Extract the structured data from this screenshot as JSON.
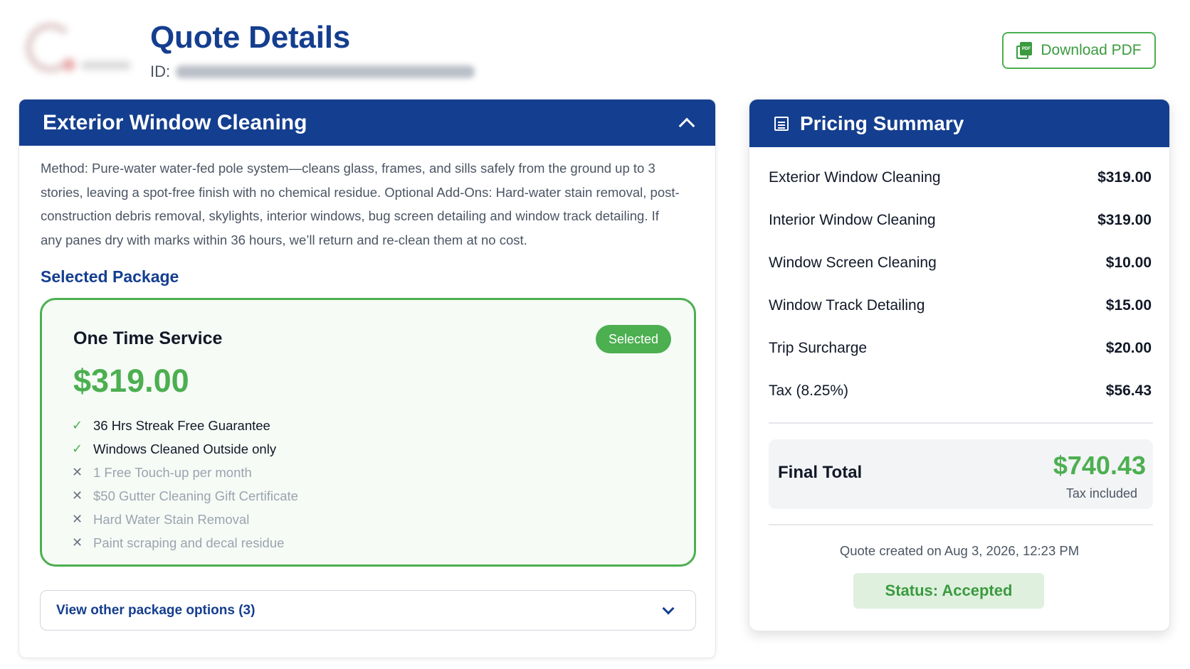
{
  "header": {
    "title": "Quote Details",
    "id_label": "ID:",
    "download_label": "Download PDF",
    "download_icon": "pdf-icon",
    "pdf_icon_text": "PDF"
  },
  "service": {
    "title": "Exterior Window Cleaning",
    "description": "Method: Pure-water water-fed pole system—cleans glass, frames, and sills safely from the ground up to 3 stories, leaving a spot-free finish with no chemical residue. Optional Add-Ons: Hard-water stain removal, post-construction debris removal, skylights, interior windows, bug screen detailing and window track detailing. If any panes dry with marks within 36 hours, we’ll return and re-clean them at no cost.",
    "selected_package_label": "Selected Package",
    "package": {
      "name": "One Time Service",
      "badge": "Selected",
      "price": "$319.00",
      "features": [
        {
          "text": "36 Hrs Streak Free Guarantee",
          "included": true,
          "icon": "✓"
        },
        {
          "text": "Windows Cleaned Outside only",
          "included": true,
          "icon": "✓"
        },
        {
          "text": "1 Free Touch-up per month",
          "included": false,
          "icon": "✕"
        },
        {
          "text": "$50 Gutter Cleaning Gift Certificate",
          "included": false,
          "icon": "✕"
        },
        {
          "text": "Hard Water Stain Removal",
          "included": false,
          "icon": "✕"
        },
        {
          "text": "Paint scraping and decal residue",
          "included": false,
          "icon": "✕"
        }
      ]
    },
    "other_options_label": "View other package options (3)"
  },
  "pricing": {
    "title": "Pricing Summary",
    "lines": [
      {
        "label": "Exterior Window Cleaning",
        "amount": "$319.00"
      },
      {
        "label": "Interior Window Cleaning",
        "amount": "$319.00"
      },
      {
        "label": "Window Screen Cleaning",
        "amount": "$10.00"
      },
      {
        "label": "Window Track Detailing",
        "amount": "$15.00"
      },
      {
        "label": "Trip Surcharge",
        "amount": "$20.00"
      },
      {
        "label": "Tax (8.25%)",
        "amount": "$56.43"
      }
    ],
    "final_label": "Final Total",
    "final_amount": "$740.43",
    "tax_note": "Tax included",
    "created": "Quote created on Aug 3, 2026, 12:23 PM",
    "status": "Status: Accepted"
  },
  "colors": {
    "brand_blue": "#143e8f",
    "accent_green": "#4caf50",
    "status_bg": "#dff0df"
  }
}
